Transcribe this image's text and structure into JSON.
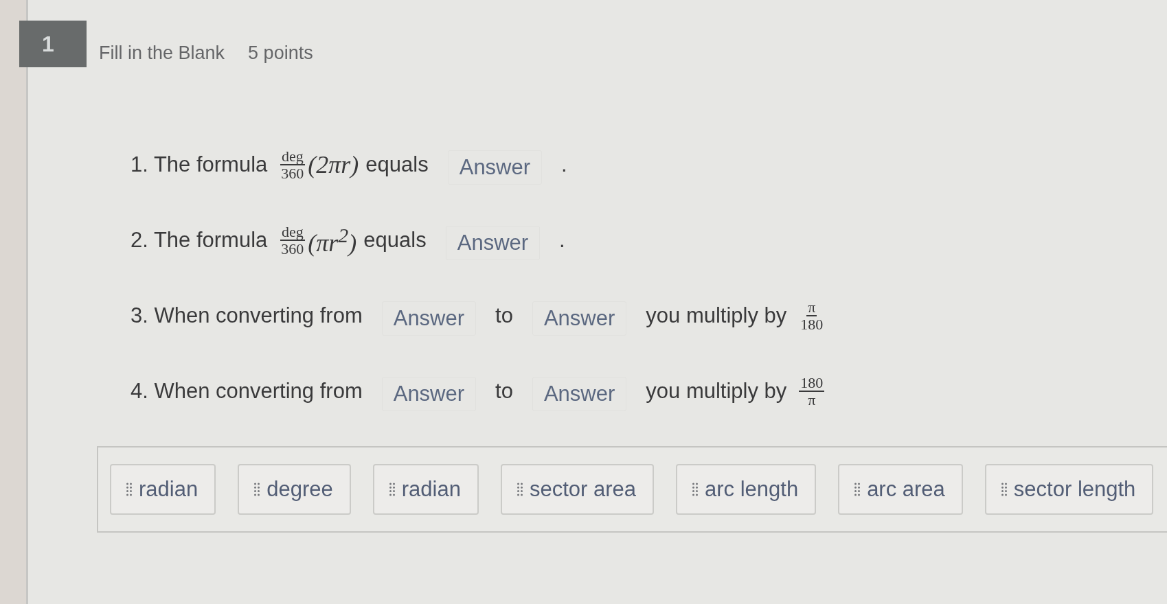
{
  "question": {
    "number": "1",
    "title": "Fill in the Blank",
    "points": "5 points"
  },
  "statements": [
    {
      "parts": [
        {
          "kind": "text",
          "text": "1. The formula"
        },
        {
          "kind": "fraction",
          "numerator": "deg",
          "denominator": "360"
        },
        {
          "kind": "math",
          "text": "(2πr)"
        },
        {
          "kind": "text",
          "text": "equals"
        },
        {
          "kind": "blank",
          "placeholder": "Answer"
        },
        {
          "kind": "text",
          "text": "."
        }
      ]
    },
    {
      "parts": [
        {
          "kind": "text",
          "text": "2. The formula"
        },
        {
          "kind": "fraction",
          "numerator": "deg",
          "denominator": "360"
        },
        {
          "kind": "math",
          "text": "(πr$^{2}$)"
        },
        {
          "kind": "text",
          "text": "equals"
        },
        {
          "kind": "blank",
          "placeholder": "Answer"
        },
        {
          "kind": "text",
          "text": "."
        }
      ]
    },
    {
      "parts": [
        {
          "kind": "text",
          "text": "3. When converting from"
        },
        {
          "kind": "blank",
          "placeholder": "Answer"
        },
        {
          "kind": "text",
          "text": "to"
        },
        {
          "kind": "blank",
          "placeholder": "Answer"
        },
        {
          "kind": "text",
          "text": "you multiply by"
        },
        {
          "kind": "fraction",
          "numerator": "π",
          "denominator": "180"
        }
      ]
    },
    {
      "parts": [
        {
          "kind": "text",
          "text": "4. When converting from"
        },
        {
          "kind": "blank",
          "placeholder": "Answer"
        },
        {
          "kind": "text",
          "text": "to"
        },
        {
          "kind": "blank",
          "placeholder": "Answer"
        },
        {
          "kind": "text",
          "text": "you multiply by"
        },
        {
          "kind": "fraction",
          "numerator": "180",
          "denominator": "π"
        }
      ]
    }
  ],
  "word_bank": [
    {
      "label": "radian"
    },
    {
      "label": "degree"
    },
    {
      "label": "radian"
    },
    {
      "label": "sector area"
    },
    {
      "label": "arc length"
    },
    {
      "label": "arc area"
    },
    {
      "label": "sector length"
    }
  ]
}
